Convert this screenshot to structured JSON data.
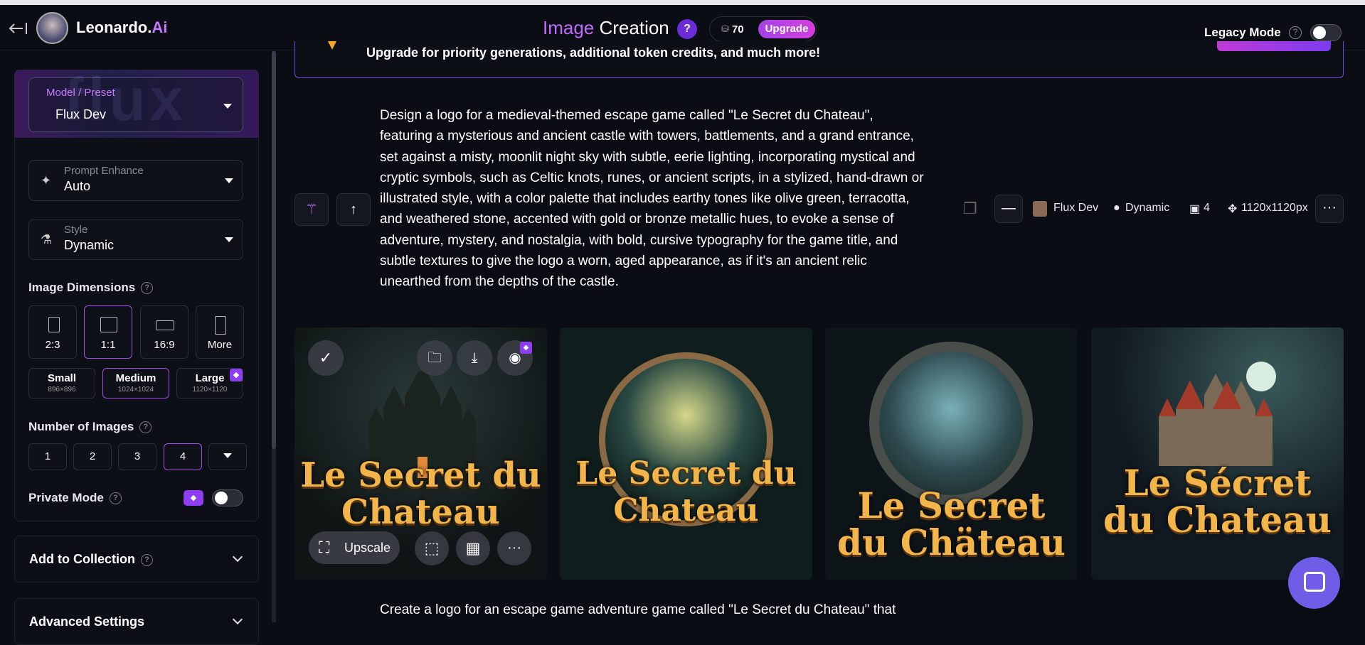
{
  "header": {
    "brand": "Leonardo.",
    "brand_ai": "Ai",
    "title_image": "Image",
    "title_rest": " Creation",
    "help": "?",
    "tokens": "70",
    "upgrade": "Upgrade",
    "legacy_mode": "Legacy Mode"
  },
  "banner": {
    "text": "Upgrade for priority generations, additional token credits, and much more!"
  },
  "sidebar": {
    "model_label": "Model / Preset",
    "model_value": "Flux Dev",
    "model_art_text": "flux",
    "enhance_label": "Prompt Enhance",
    "enhance_value": "Auto",
    "style_label": "Style",
    "style_value": "Dynamic",
    "dimensions_label": "Image Dimensions",
    "dims": [
      "2:3",
      "1:1",
      "16:9",
      "More"
    ],
    "sizes": [
      {
        "label": "Small",
        "px": "896×896"
      },
      {
        "label": "Medium",
        "px": "1024×1024"
      },
      {
        "label": "Large",
        "px": "1120×1120"
      }
    ],
    "num_images_label": "Number of Images",
    "nums": [
      "1",
      "2",
      "3",
      "4"
    ],
    "private_mode": "Private Mode",
    "add_to_collection": "Add to Collection",
    "advanced_settings": "Advanced Settings"
  },
  "generation": {
    "prompt": "Design a logo for a medieval-themed escape game called \"Le Secret du Chateau\", featuring a mysterious and ancient castle with towers, battlements, and a grand entrance, set against a misty, moonlit night sky with subtle, eerie lighting, incorporating mystical and cryptic symbols, such as Celtic knots, runes, or ancient scripts, in a stylized, hand-drawn or illustrated style, with a color palette that includes earthy tones like olive green, terracotta, and weathered stone, accented with gold or bronze metallic hues, to evoke a sense of adventure, mystery, and nostalgia, with bold, cursive typography for the game title, and subtle textures to give the logo a worn, aged appearance, as if it's an ancient relic unearthed from the depths of the castle.",
    "model": "Flux Dev",
    "style": "Dynamic",
    "count": "4",
    "size": "1120x1120px",
    "upscale": "Upscale",
    "images": [
      {
        "line1": "Le Secret du",
        "line2": "Chateau"
      },
      {
        "line1": "Le Secret du",
        "line2": "Chateau"
      },
      {
        "line1": "Le Secret",
        "line2": "du Chäteau"
      },
      {
        "line1": "Le Sécret",
        "line2": "du Chateau"
      }
    ]
  },
  "next_prompt": "Create a logo for an escape game adventure game called \"Le Secret du Chateau\" that"
}
